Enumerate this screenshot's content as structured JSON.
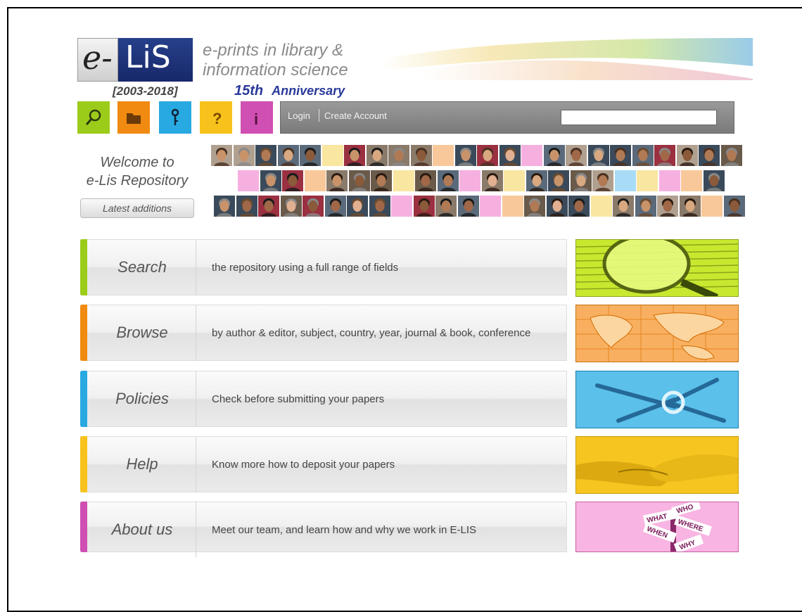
{
  "logo": {
    "e": "e-",
    "lis": "LiS",
    "years": "[2003-2018]"
  },
  "tagline": {
    "line1": "e-prints in library &",
    "line2": "information science"
  },
  "anniversary": {
    "number": "15th",
    "word": "Anniversary"
  },
  "toolbar_icons": [
    {
      "name": "search-icon",
      "color": "#9ccc1a"
    },
    {
      "name": "folder-icon",
      "color": "#f08a10"
    },
    {
      "name": "key-icon",
      "color": "#29a9e1"
    },
    {
      "name": "question-icon",
      "color": "#f7c21b"
    },
    {
      "name": "info-icon",
      "color": "#cf4fb2"
    }
  ],
  "navbar": {
    "login": "Login",
    "create_account": "Create Account",
    "search_value": ""
  },
  "welcome": {
    "line1": "Welcome to",
    "line2": "e-Lis Repository",
    "latest": "Latest additions"
  },
  "sections": [
    {
      "label": "Search",
      "desc": "the repository using a full range of fields",
      "color": "#9ccc1a"
    },
    {
      "label": "Browse",
      "desc": "by author & editor, subject, country, year, journal & book, conference",
      "color": "#f08a10"
    },
    {
      "label": "Policies",
      "desc": "Check before submitting your papers",
      "color": "#29a9e1"
    },
    {
      "label": "Help",
      "desc": "Know more how to deposit your papers",
      "color": "#f7c21b"
    },
    {
      "label": "About us",
      "desc": "Meet our team, and learn how and why we work in E-LIS",
      "color": "#cf4fb2"
    }
  ],
  "signpost_words": [
    "WHAT",
    "WHERE",
    "WHEN",
    "WHY",
    "WHO"
  ]
}
